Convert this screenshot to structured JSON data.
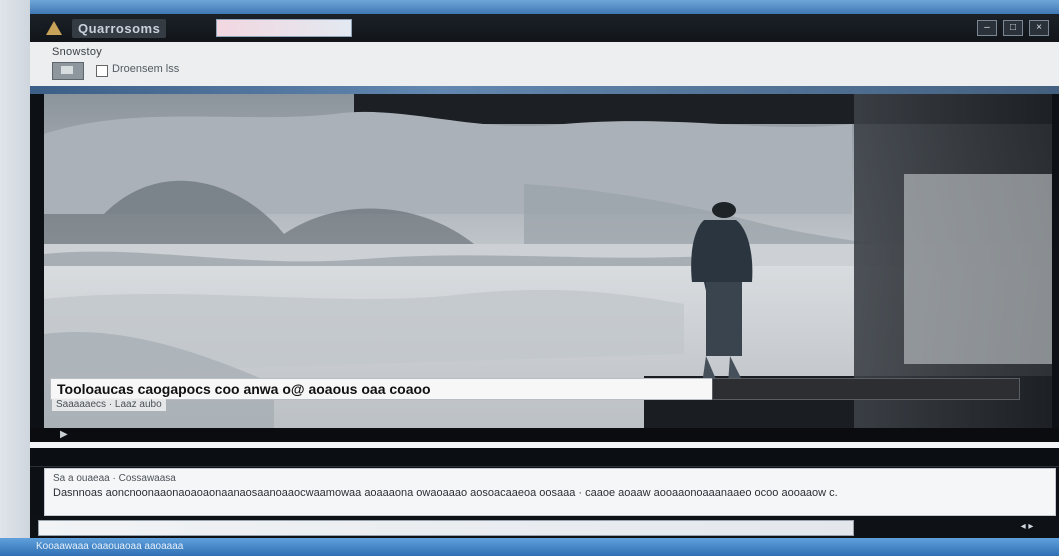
{
  "window": {
    "app_name": "Quarrosoms",
    "address": "",
    "controls": [
      "–",
      "□",
      "×"
    ]
  },
  "toolbar": {
    "title": "Snowstoy",
    "label": "Droensem lss"
  },
  "breadcrumb": "",
  "photo": {
    "subject": "person standing on snowy field under cloudy sky"
  },
  "caption": {
    "headline": "Tooloaucas caogapocs coo anwa o@ aoaous oaa coaoo",
    "byline": "Saaaaaecs · Laaz aubo"
  },
  "player": {
    "play_icon": "▶"
  },
  "strip": {
    "text": ""
  },
  "description": {
    "meta": "Sa a ouaeaa · Cossawaasa",
    "text": "Dasnnoas aoncnoonaaonaoaoaonaanaosaanoaaocwaamowaa aoaaaona owaoaaao aosoacaaeoa oosaaa ·  caaoe aoaaw aooaaonoaaanaaeo ocoo aooaaow c."
  },
  "comment": {
    "placeholder": ""
  },
  "taskbar": {
    "text": "Kooaawaaa oaaouaoaa aaoaaaa"
  },
  "colors": {
    "taskbar": "#3f78b4",
    "titlebar": "#111519",
    "toolbar": "#eceeef"
  }
}
